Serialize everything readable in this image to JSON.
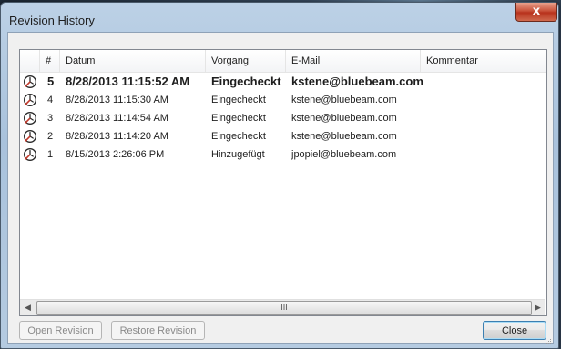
{
  "window": {
    "title": "Revision History",
    "close_glyph": "x"
  },
  "table": {
    "columns": [
      "#",
      "Datum",
      "Vorgang",
      "E-Mail",
      "Kommentar"
    ],
    "rows": [
      {
        "num": "5",
        "date": "8/28/2013 11:15:52 AM",
        "action": "Eingecheckt",
        "email": "kstene@bluebeam.com",
        "comment": "",
        "icon": "revision-clock-icon",
        "bold": true
      },
      {
        "num": "4",
        "date": "8/28/2013 11:15:30 AM",
        "action": "Eingecheckt",
        "email": "kstene@bluebeam.com",
        "comment": "",
        "icon": "revision-clock-icon",
        "bold": false
      },
      {
        "num": "3",
        "date": "8/28/2013 11:14:54 AM",
        "action": "Eingecheckt",
        "email": "kstene@bluebeam.com",
        "comment": "",
        "icon": "revision-clock-icon",
        "bold": false
      },
      {
        "num": "2",
        "date": "8/28/2013 11:14:20 AM",
        "action": "Eingecheckt",
        "email": "kstene@bluebeam.com",
        "comment": "",
        "icon": "revision-clock-icon",
        "bold": false
      },
      {
        "num": "1",
        "date": "8/15/2013 2:26:06 PM",
        "action": "Hinzugefügt",
        "email": "jpopiel@bluebeam.com",
        "comment": "",
        "icon": "revision-clock-icon",
        "bold": false
      }
    ]
  },
  "scrollbar": {
    "left_arrow": "◀",
    "right_arrow": "▶",
    "thumb_grip": "III"
  },
  "buttons": {
    "open_revision": "Open Revision",
    "restore_revision": "Restore Revision",
    "close": "Close"
  }
}
